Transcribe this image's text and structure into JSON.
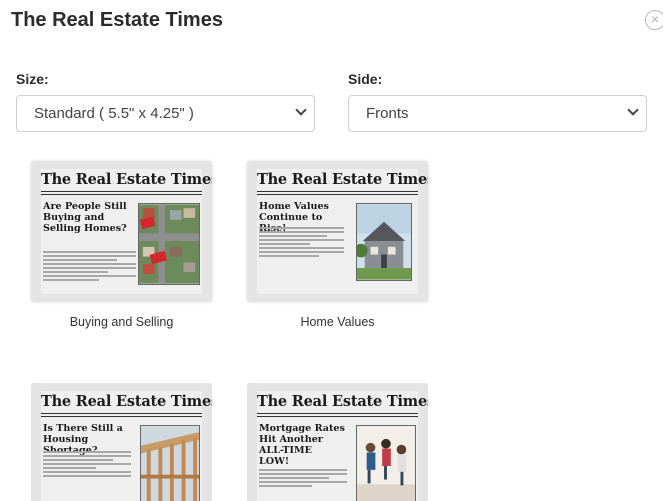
{
  "modal": {
    "title": "The Real Estate Times",
    "close_symbol": "×"
  },
  "size_field": {
    "label": "Size:",
    "value": "Standard ( 5.5\" x 4.25\" )"
  },
  "side_field": {
    "label": "Side:",
    "value": "Fronts"
  },
  "cards": [
    {
      "paper_title": "The Real Estate Times",
      "headline": "Are People Still Buying and Selling Homes?",
      "caption": "Buying and Selling",
      "photo_icon": "aerial-houses-photo"
    },
    {
      "paper_title": "The Real Estate Times",
      "headline": "Home Values Continue to Rise!",
      "caption": "Home Values",
      "photo_icon": "house-photo"
    },
    {
      "paper_title": "The Real Estate Times",
      "headline": "Is There Still a Housing Shortage?",
      "caption": "",
      "photo_icon": "construction-frame-photo"
    },
    {
      "paper_title": "The Real Estate Times",
      "headline": "Mortgage Rates Hit Another ALL-TIME LOW!",
      "caption": "",
      "photo_icon": "jumping-family-photo"
    }
  ]
}
